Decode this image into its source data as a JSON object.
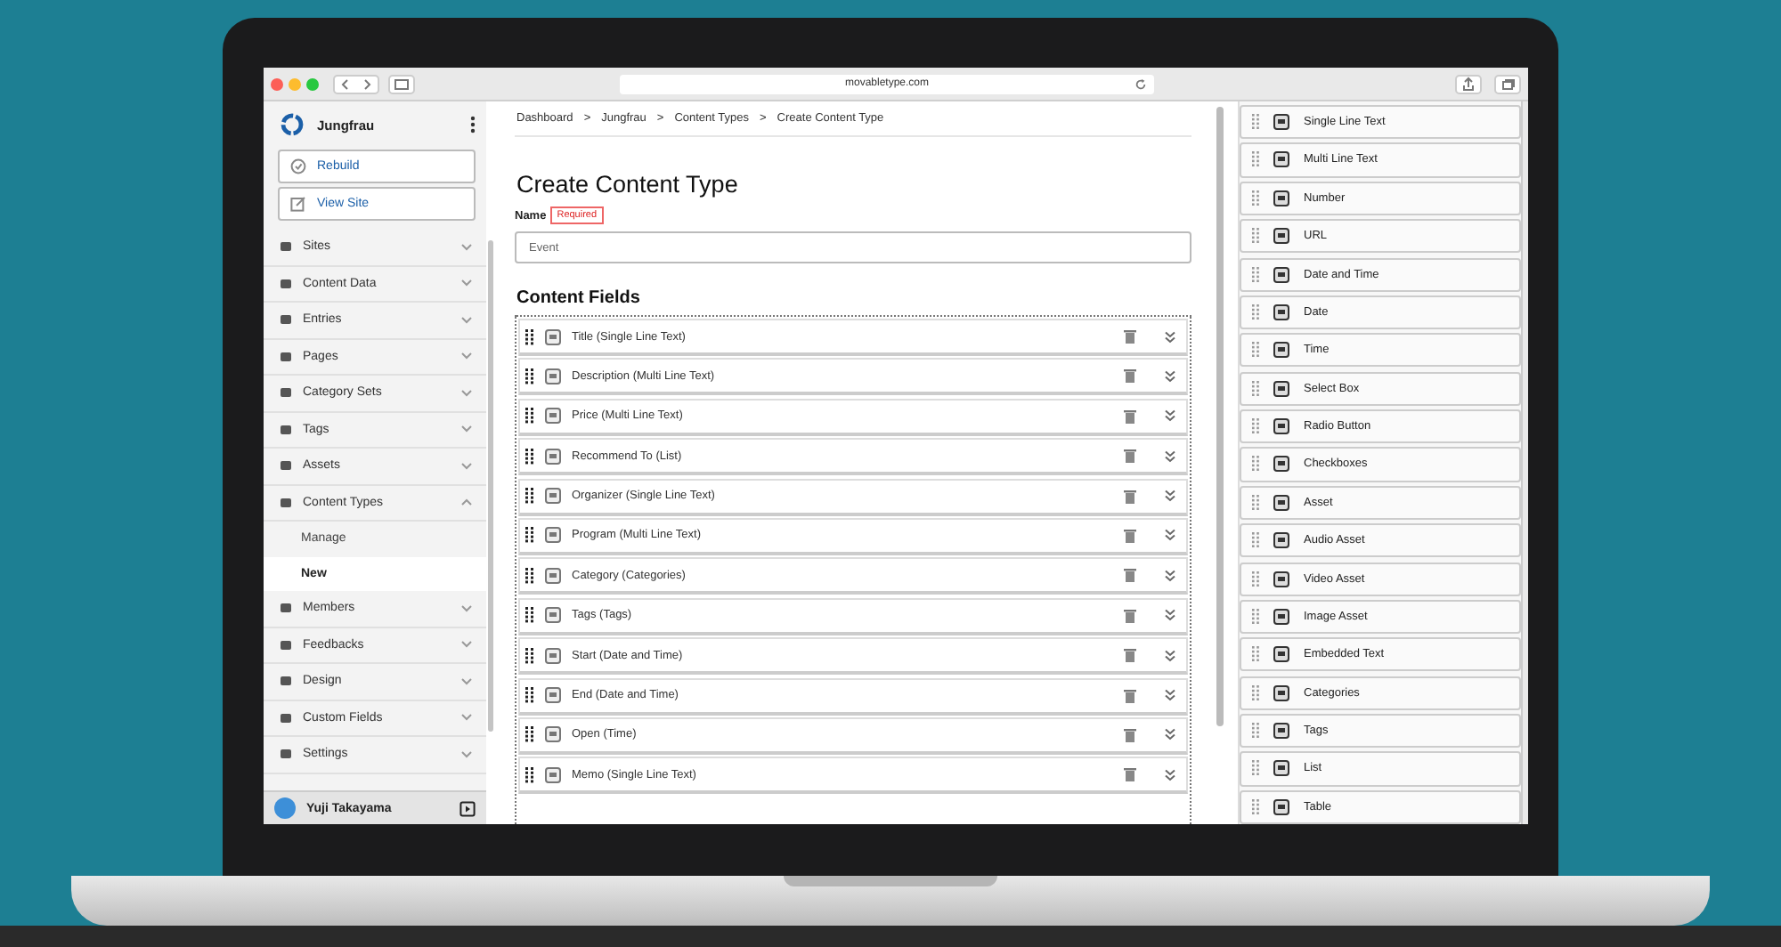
{
  "browser": {
    "address": "movabletype.com"
  },
  "sidebar": {
    "site_name": "Jungfrau",
    "actions": [
      "Rebuild",
      "View Site"
    ],
    "items": [
      {
        "label": "Sites",
        "expanded": false
      },
      {
        "label": "Content Data",
        "expanded": false
      },
      {
        "label": "Entries",
        "expanded": false
      },
      {
        "label": "Pages",
        "expanded": false
      },
      {
        "label": "Category Sets",
        "expanded": false
      },
      {
        "label": "Tags",
        "expanded": false
      },
      {
        "label": "Assets",
        "expanded": false
      },
      {
        "label": "Content Types",
        "expanded": true,
        "children": [
          {
            "label": "Manage",
            "selected": false
          },
          {
            "label": "New",
            "selected": true
          }
        ]
      },
      {
        "label": "Members",
        "expanded": false
      },
      {
        "label": "Feedbacks",
        "expanded": false
      },
      {
        "label": "Design",
        "expanded": false
      },
      {
        "label": "Custom Fields",
        "expanded": false
      },
      {
        "label": "Settings",
        "expanded": false
      }
    ],
    "user": "Yuji Takayama"
  },
  "breadcrumbs": [
    "Dashboard",
    "Jungfrau",
    "Content Types",
    "Create Content Type"
  ],
  "breadcrumb_separator": ">",
  "title": "Create Content Type",
  "name_field": {
    "label": "Name",
    "badge": "Required",
    "value": "Event"
  },
  "fields_heading": "Content Fields",
  "fields": [
    "Title (Single Line Text)",
    "Description (Multi Line Text)",
    "Price (Multi Line Text)",
    "Recommend To (List)",
    "Organizer (Single Line Text)",
    "Program (Multi Line Text)",
    "Category (Categories)",
    "Tags (Tags)",
    "Start (Date and Time)",
    "End (Date and Time)",
    "Open (Time)",
    "Memo (Single Line Text)"
  ],
  "palette": [
    "Single Line Text",
    "Multi Line Text",
    "Number",
    "URL",
    "Date and Time",
    "Date",
    "Time",
    "Select Box",
    "Radio Button",
    "Checkboxes",
    "Asset",
    "Audio Asset",
    "Video Asset",
    "Image Asset",
    "Embedded Text",
    "Categories",
    "Tags",
    "List",
    "Table"
  ]
}
